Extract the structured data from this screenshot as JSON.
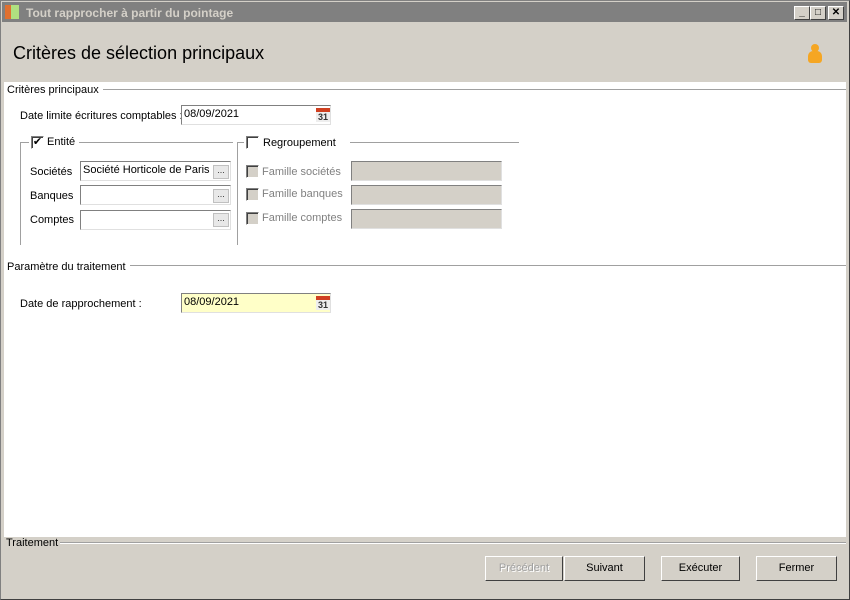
{
  "window": {
    "title": "Tout rapprocher à partir du pointage",
    "minimize": "_",
    "maximize": "□",
    "close": "✕"
  },
  "header": {
    "title": "Critères de sélection principaux",
    "icon": "user-icon"
  },
  "main_criteria": {
    "legend": "Critères principaux",
    "date_limit_label": "Date limite écritures comptables :",
    "date_limit_value": "08/09/2021",
    "calendar_day": "31"
  },
  "entity": {
    "label": "Entité",
    "checked": true,
    "societes_label": "Sociétés",
    "societes_value": "Société Horticole de Paris",
    "banques_label": "Banques",
    "banques_value": "",
    "comptes_label": "Comptes",
    "comptes_value": "",
    "ellipsis": "..."
  },
  "grouping": {
    "label": "Regroupement",
    "checked": false,
    "famille_societes": "Famille sociétés",
    "famille_banques": "Famille banques",
    "famille_comptes": "Famille comptes"
  },
  "processing_params": {
    "legend": "Paramètre du traitement",
    "date_label": "Date de rapprochement :",
    "date_value": "08/09/2021",
    "calendar_day": "31"
  },
  "footer": {
    "legend": "Traitement",
    "previous": "Précédent",
    "next": "Suivant",
    "execute": "Exécuter",
    "close": "Fermer"
  }
}
